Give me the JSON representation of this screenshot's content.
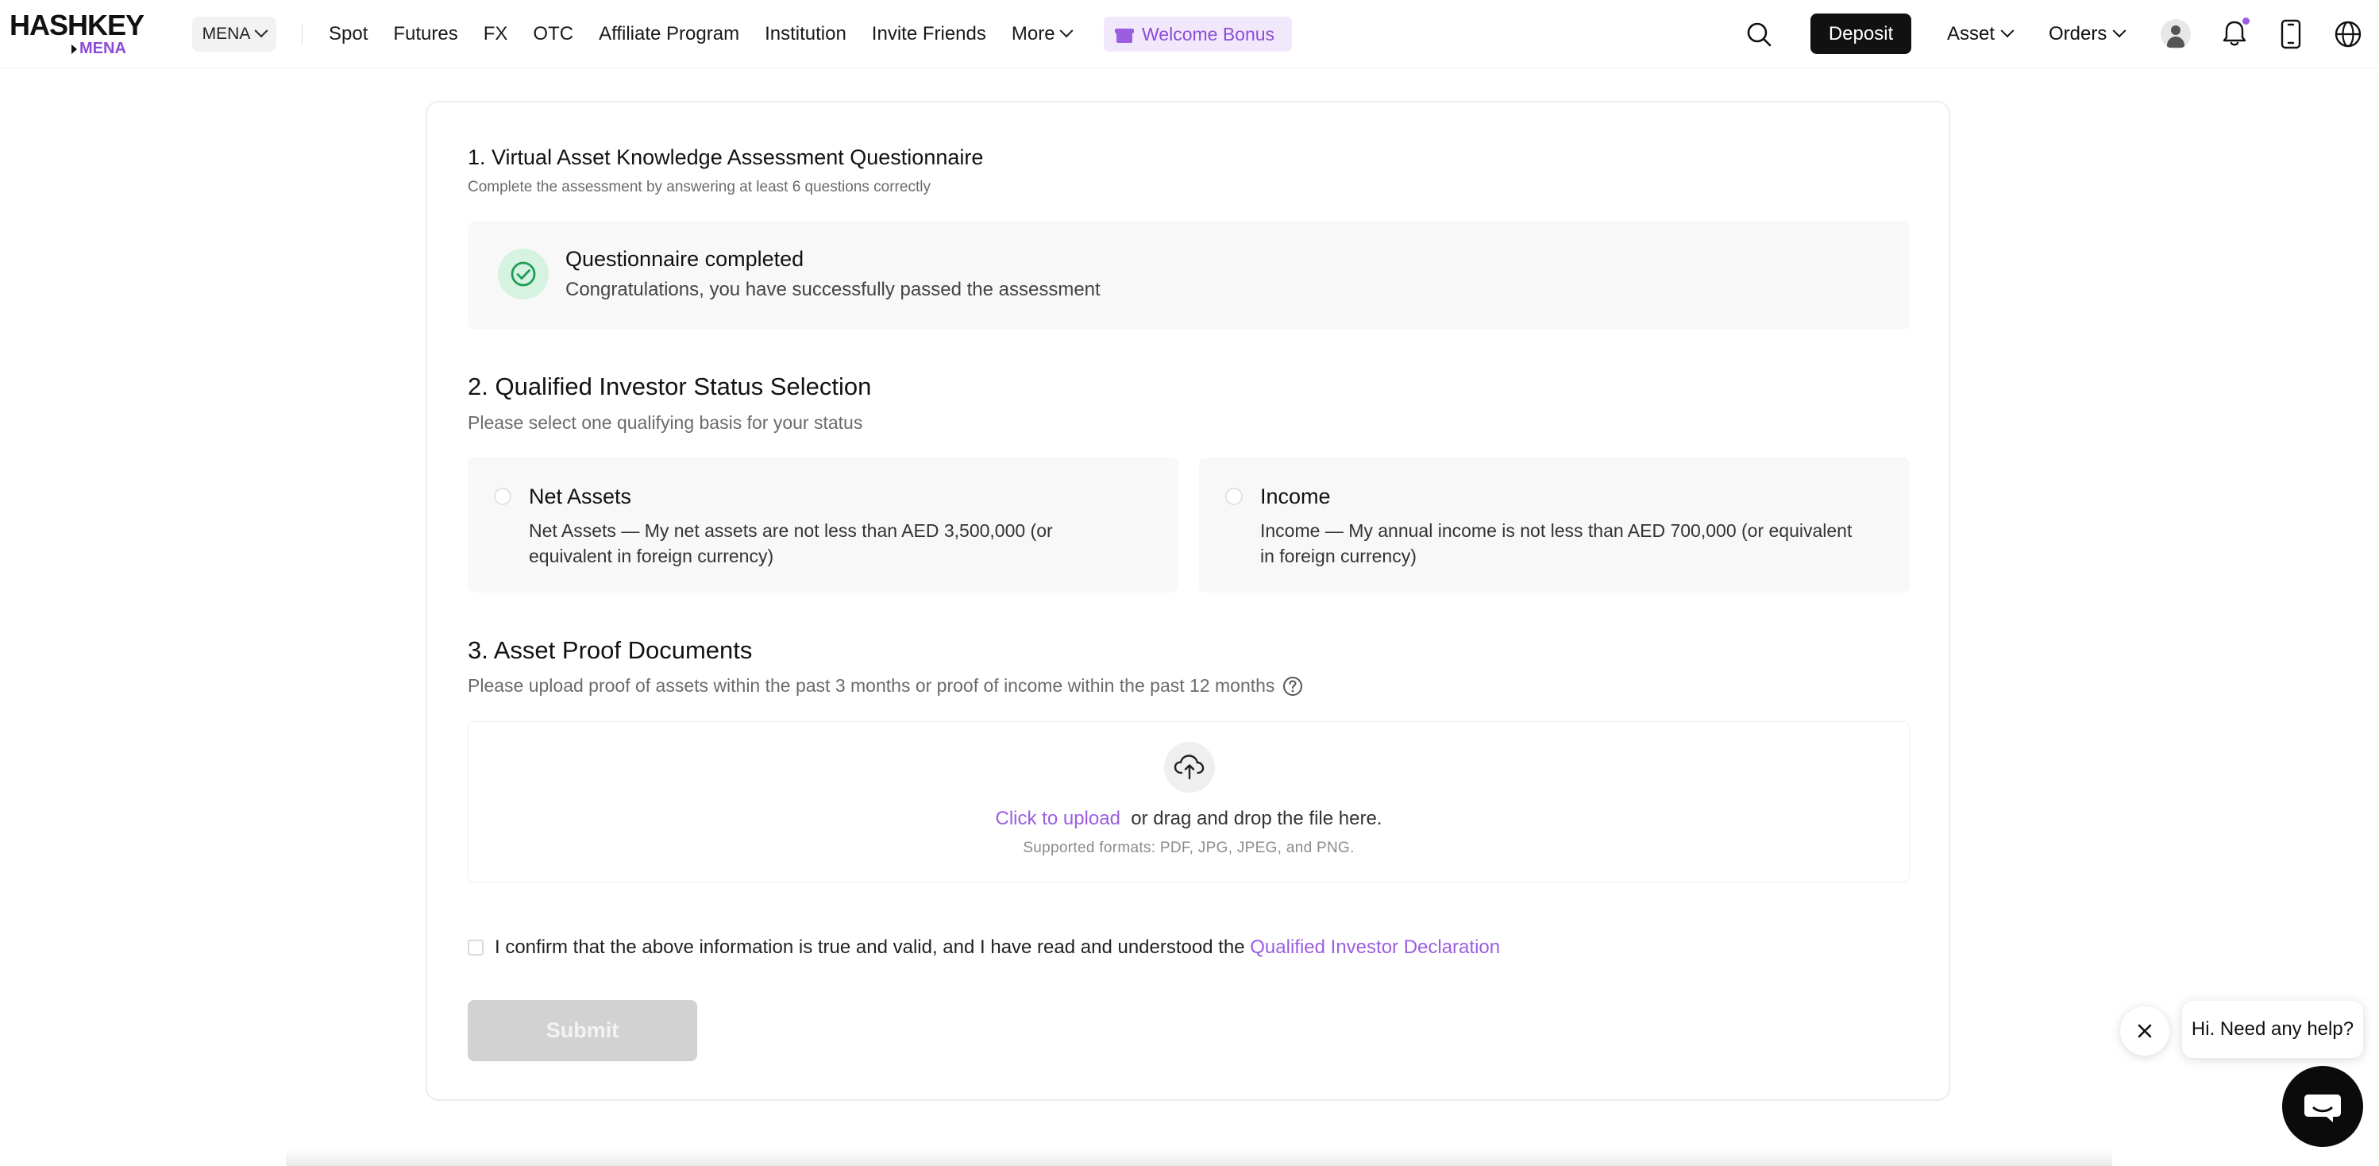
{
  "brand": {
    "name": "HASHKEY",
    "region_tag": "MENA"
  },
  "topbar": {
    "region": "MENA",
    "nav": [
      "Spot",
      "Futures",
      "FX",
      "OTC",
      "Affiliate Program",
      "Institution",
      "Invite Friends",
      "More"
    ],
    "welcome_bonus": "Welcome Bonus",
    "deposit": "Deposit",
    "asset": "Asset",
    "orders": "Orders",
    "icons": [
      "search-icon",
      "user-avatar-icon",
      "bell-icon",
      "phone-icon",
      "globe-icon"
    ]
  },
  "section1": {
    "title": "1. Virtual Asset Knowledge Assessment Questionnaire",
    "subtitle": "Complete the assessment by answering at least 6 questions correctly",
    "status_title": "Questionnaire completed",
    "status_text": "Congratulations, you have successfully passed the assessment"
  },
  "section2": {
    "title": "2. Qualified Investor Status Selection",
    "subtitle": "Please select one qualifying basis for your status",
    "options": [
      {
        "title": "Net Assets",
        "text": "Net Assets — My net assets are not less than AED 3,500,000 (or equivalent in foreign currency)",
        "selected": false
      },
      {
        "title": "Income",
        "text": "Income — My annual income is not less than AED 700,000 (or equivalent in foreign currency)",
        "selected": false
      }
    ]
  },
  "section3": {
    "title": "3. Asset Proof Documents",
    "subtitle": "Please upload proof of assets within the past 3 months or proof of income within the past 12 months",
    "upload_link": "Click to upload",
    "upload_text": "or drag and drop the file here.",
    "formats": "Supported formats: PDF, JPG, JPEG, and PNG."
  },
  "confirm": {
    "text": "I confirm that the above information is true and valid, and I have read and understood the",
    "link": "Qualified Investor Declaration",
    "checked": false
  },
  "submit_label": "Submit",
  "chat": {
    "greeting": "Hi. Need any help?"
  },
  "colors": {
    "accent": "#9b5ee0",
    "success": "#1f9d55",
    "dark": "#111111"
  }
}
